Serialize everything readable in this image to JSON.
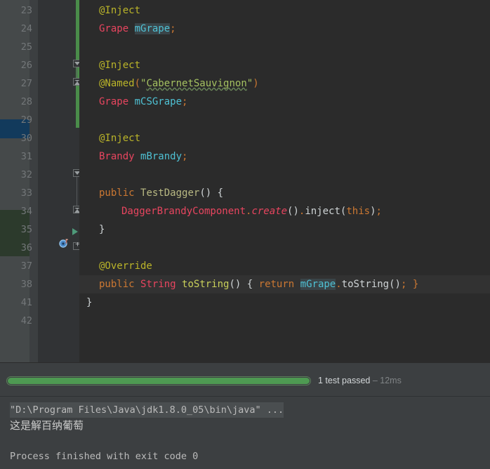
{
  "editor": {
    "lines": [
      {
        "num": "23",
        "indent": 0,
        "tokens": [
          {
            "t": "@Inject",
            "c": "t-anno"
          }
        ]
      },
      {
        "num": "24",
        "indent": 0,
        "tokens": [
          {
            "t": "Grape",
            "c": "t-type"
          },
          {
            "t": " ",
            "c": "t-plain"
          },
          {
            "t": "mGrape",
            "c": "t-field hl-ident"
          },
          {
            "t": ";",
            "c": "t-punc"
          }
        ]
      },
      {
        "num": "25",
        "indent": 0,
        "tokens": []
      },
      {
        "num": "26",
        "indent": 0,
        "tokens": [
          {
            "t": "@Inject",
            "c": "t-anno"
          }
        ]
      },
      {
        "num": "27",
        "indent": 0,
        "tokens": [
          {
            "t": "@Named",
            "c": "t-anno"
          },
          {
            "t": "(",
            "c": "t-punc"
          },
          {
            "t": "\"",
            "c": "t-str"
          },
          {
            "t": "CabernetSauvignon",
            "c": "t-str spell"
          },
          {
            "t": "\"",
            "c": "t-str"
          },
          {
            "t": ")",
            "c": "t-punc"
          }
        ]
      },
      {
        "num": "28",
        "indent": 0,
        "tokens": [
          {
            "t": "Grape",
            "c": "t-type"
          },
          {
            "t": " ",
            "c": "t-plain"
          },
          {
            "t": "mCSGrape",
            "c": "t-field"
          },
          {
            "t": ";",
            "c": "t-punc"
          }
        ]
      },
      {
        "num": "29",
        "indent": 0,
        "tokens": []
      },
      {
        "num": "30",
        "indent": 0,
        "tokens": [
          {
            "t": "@Inject",
            "c": "t-anno"
          }
        ]
      },
      {
        "num": "31",
        "indent": 0,
        "tokens": [
          {
            "t": "Brandy",
            "c": "t-type"
          },
          {
            "t": " ",
            "c": "t-plain"
          },
          {
            "t": "mBrandy",
            "c": "t-field"
          },
          {
            "t": ";",
            "c": "t-punc"
          }
        ]
      },
      {
        "num": "32",
        "indent": 0,
        "tokens": []
      },
      {
        "num": "33",
        "indent": 0,
        "tokens": [
          {
            "t": "public",
            "c": "t-kw"
          },
          {
            "t": " ",
            "c": "t-plain"
          },
          {
            "t": "TestDagger",
            "c": "t-cls"
          },
          {
            "t": "()",
            "c": "t-white"
          },
          {
            "t": " ",
            "c": "t-plain"
          },
          {
            "t": "{",
            "c": "t-white"
          }
        ]
      },
      {
        "num": "34",
        "indent": 1,
        "tokens": [
          {
            "t": "DaggerBrandyComponent",
            "c": "t-cls2"
          },
          {
            "t": ".",
            "c": "t-punc"
          },
          {
            "t": "create",
            "c": "t-meth-i"
          },
          {
            "t": "()",
            "c": "t-white"
          },
          {
            "t": ".",
            "c": "t-punc"
          },
          {
            "t": "inject",
            "c": "t-white"
          },
          {
            "t": "(",
            "c": "t-white"
          },
          {
            "t": "this",
            "c": "t-kw"
          },
          {
            "t": ")",
            "c": "t-white"
          },
          {
            "t": ";",
            "c": "t-punc"
          }
        ]
      },
      {
        "num": "35",
        "indent": 0,
        "tokens": [
          {
            "t": "}",
            "c": "t-white"
          }
        ]
      },
      {
        "num": "36",
        "indent": 0,
        "tokens": []
      },
      {
        "num": "37",
        "indent": 0,
        "tokens": [
          {
            "t": "@Override",
            "c": "t-anno"
          }
        ]
      },
      {
        "num": "38",
        "indent": 0,
        "current": true,
        "tokens": [
          {
            "t": "public",
            "c": "t-kw"
          },
          {
            "t": " ",
            "c": "t-plain"
          },
          {
            "t": "String",
            "c": "t-type"
          },
          {
            "t": " ",
            "c": "t-plain"
          },
          {
            "t": "toString",
            "c": "t-meth"
          },
          {
            "t": "()",
            "c": "t-white"
          },
          {
            "t": " ",
            "c": "t-plain"
          },
          {
            "t": "{",
            "c": "t-white"
          },
          {
            "t": " ",
            "c": "t-plain"
          },
          {
            "t": "return",
            "c": "t-kw"
          },
          {
            "t": " ",
            "c": "t-plain"
          },
          {
            "t": "mGrape",
            "c": "t-field hl-ident"
          },
          {
            "t": ".",
            "c": "t-punc"
          },
          {
            "t": "toString",
            "c": "t-white"
          },
          {
            "t": "()",
            "c": "t-white"
          },
          {
            "t": ";",
            "c": "t-punc"
          },
          {
            "t": " ",
            "c": "t-plain"
          },
          {
            "t": "}",
            "c": "t-punc"
          }
        ]
      },
      {
        "num": "41",
        "indent": -1,
        "tokens": [
          {
            "t": "}",
            "c": "t-white"
          }
        ]
      },
      {
        "num": "42",
        "indent": -1,
        "tokens": []
      }
    ]
  },
  "test_panel": {
    "status_label": "1 test passed",
    "time_label": " – 12ms",
    "progress_percent": 100,
    "progress_color": "#4e9a52"
  },
  "console": {
    "command_line": "\"D:\\Program Files\\Java\\jdk1.8.0_05\\bin\\java\" ...",
    "output_line": "这是解百纳葡萄",
    "exit_line": "Process finished with exit code 0"
  }
}
